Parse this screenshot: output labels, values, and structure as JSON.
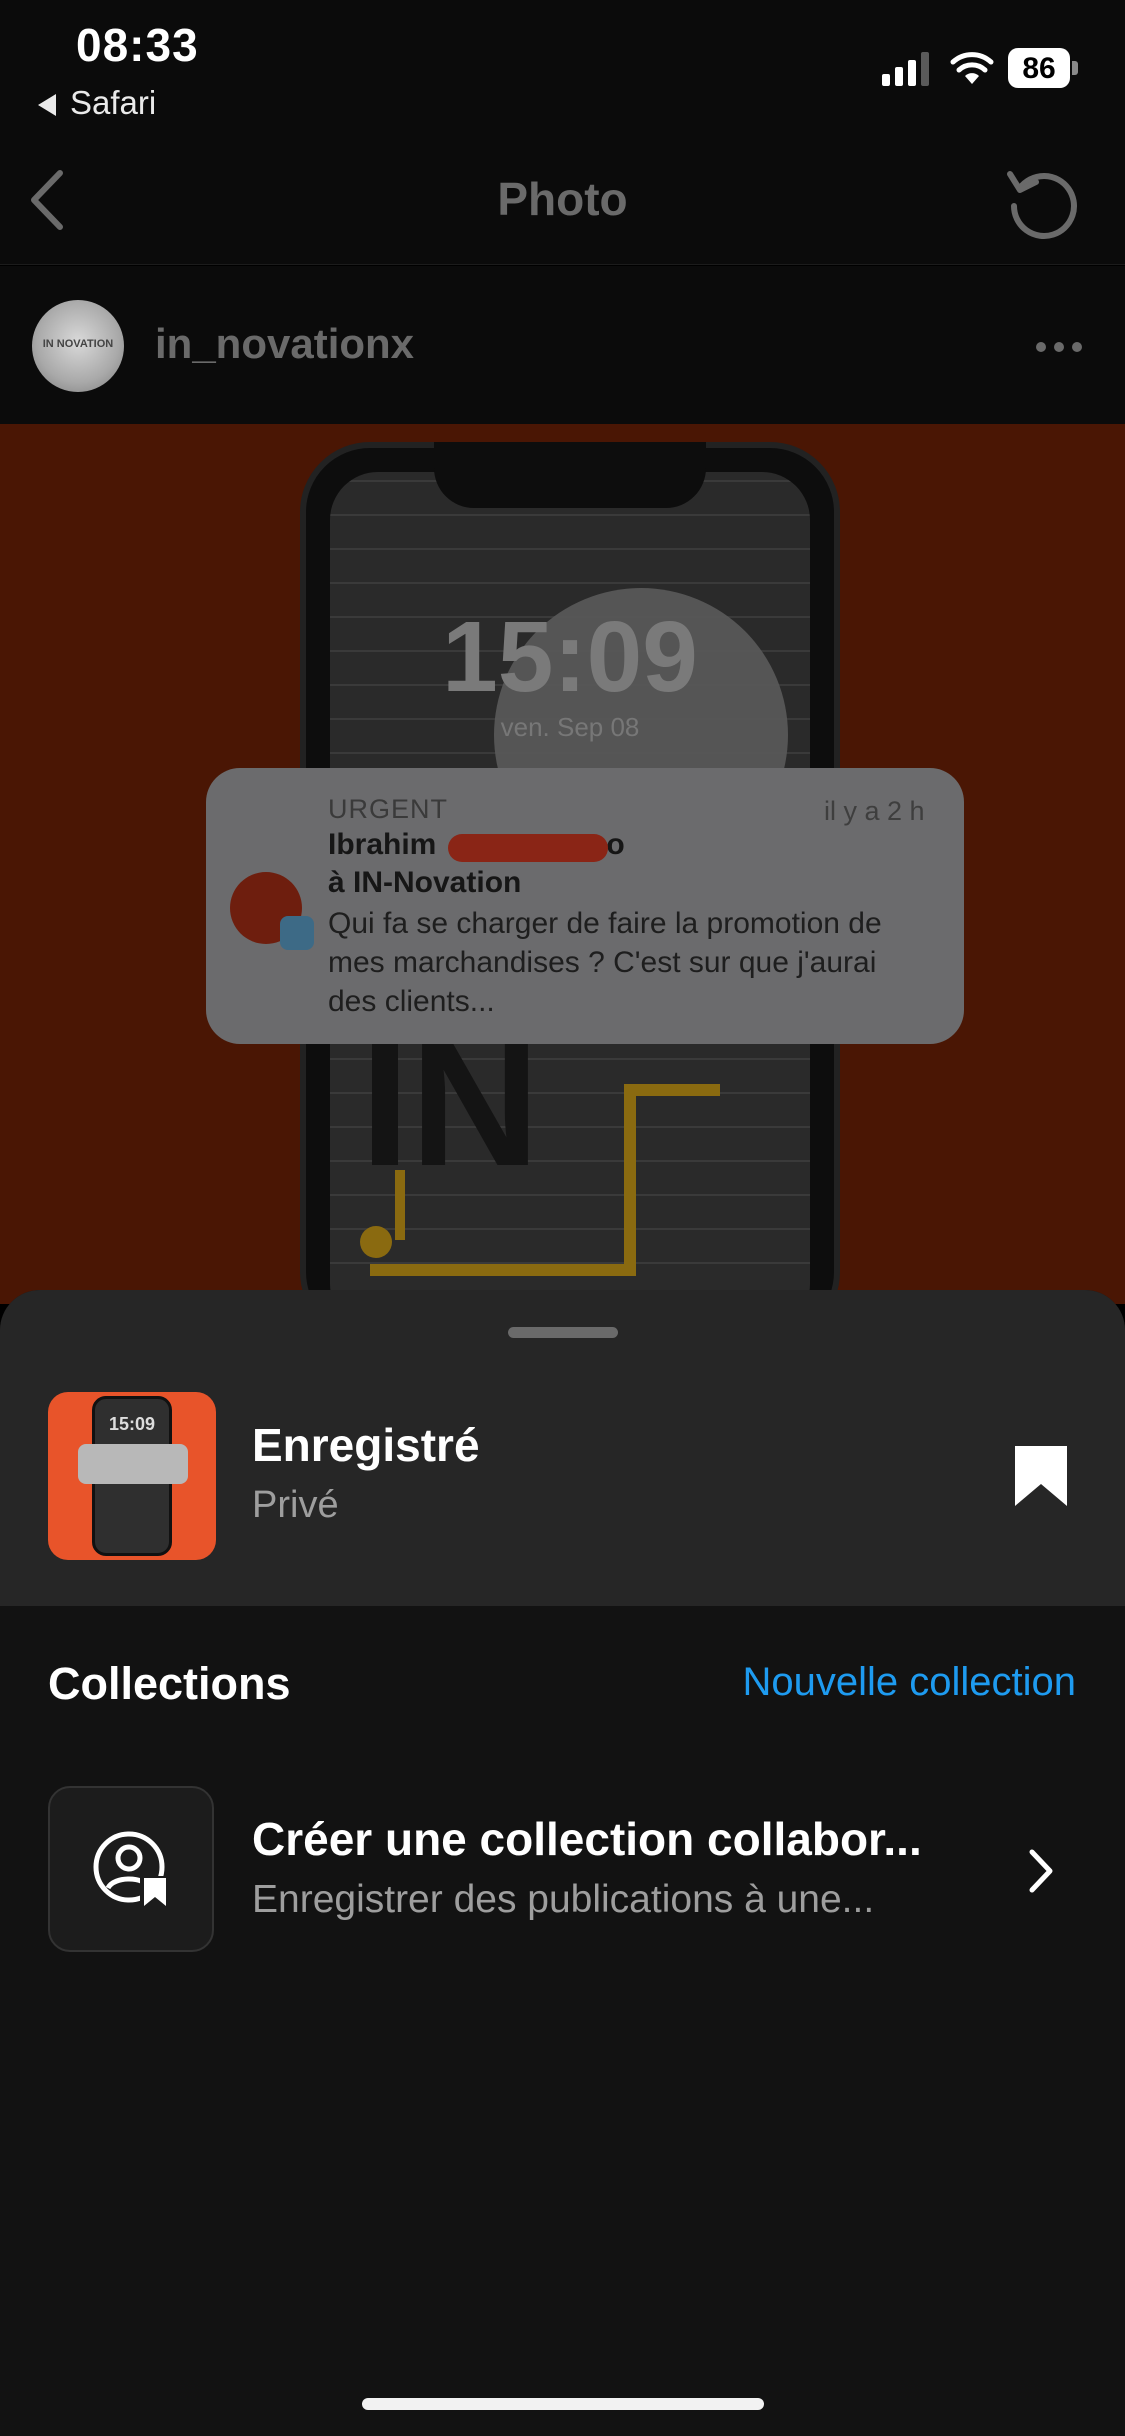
{
  "status_bar": {
    "time": "08:33",
    "back_app": "Safari",
    "battery": "86"
  },
  "nav": {
    "title": "Photo",
    "icons": {
      "back": "chevron-left-icon",
      "refresh": "refresh-icon"
    }
  },
  "post": {
    "username": "in_novationx",
    "avatar_text": "IN NOVATION",
    "more_icon": "more-horizontal-icon",
    "image": {
      "lock_time": "15:09",
      "lock_date": "ven. Sep 08",
      "big_text": "IN",
      "notification": {
        "label": "URGENT",
        "time": "il y a 2 h",
        "sender": "Ibrahim",
        "sender_suffix": "o",
        "group": "à IN-Novation",
        "body": "Qui fa se charger de faire la promotion de mes marchandises ? C'est sur que j'aurai des clients..."
      }
    }
  },
  "sheet": {
    "saved": {
      "title": "Enregistré",
      "subtitle": "Privé",
      "thumb_time": "15:09",
      "icon": "bookmark-filled-icon"
    },
    "collections": {
      "title": "Collections",
      "new_label": "Nouvelle collection"
    },
    "collab": {
      "title": "Créer une collection collabor...",
      "subtitle": "Enregistrer des publications à une...",
      "icon": "collaborative-collection-icon",
      "chevron": "chevron-right-icon"
    }
  },
  "colors": {
    "accent": "#1e9bf0",
    "sheet_bg": "#121212",
    "saved_bg": "#262626",
    "post_bg": "#e8542a"
  }
}
